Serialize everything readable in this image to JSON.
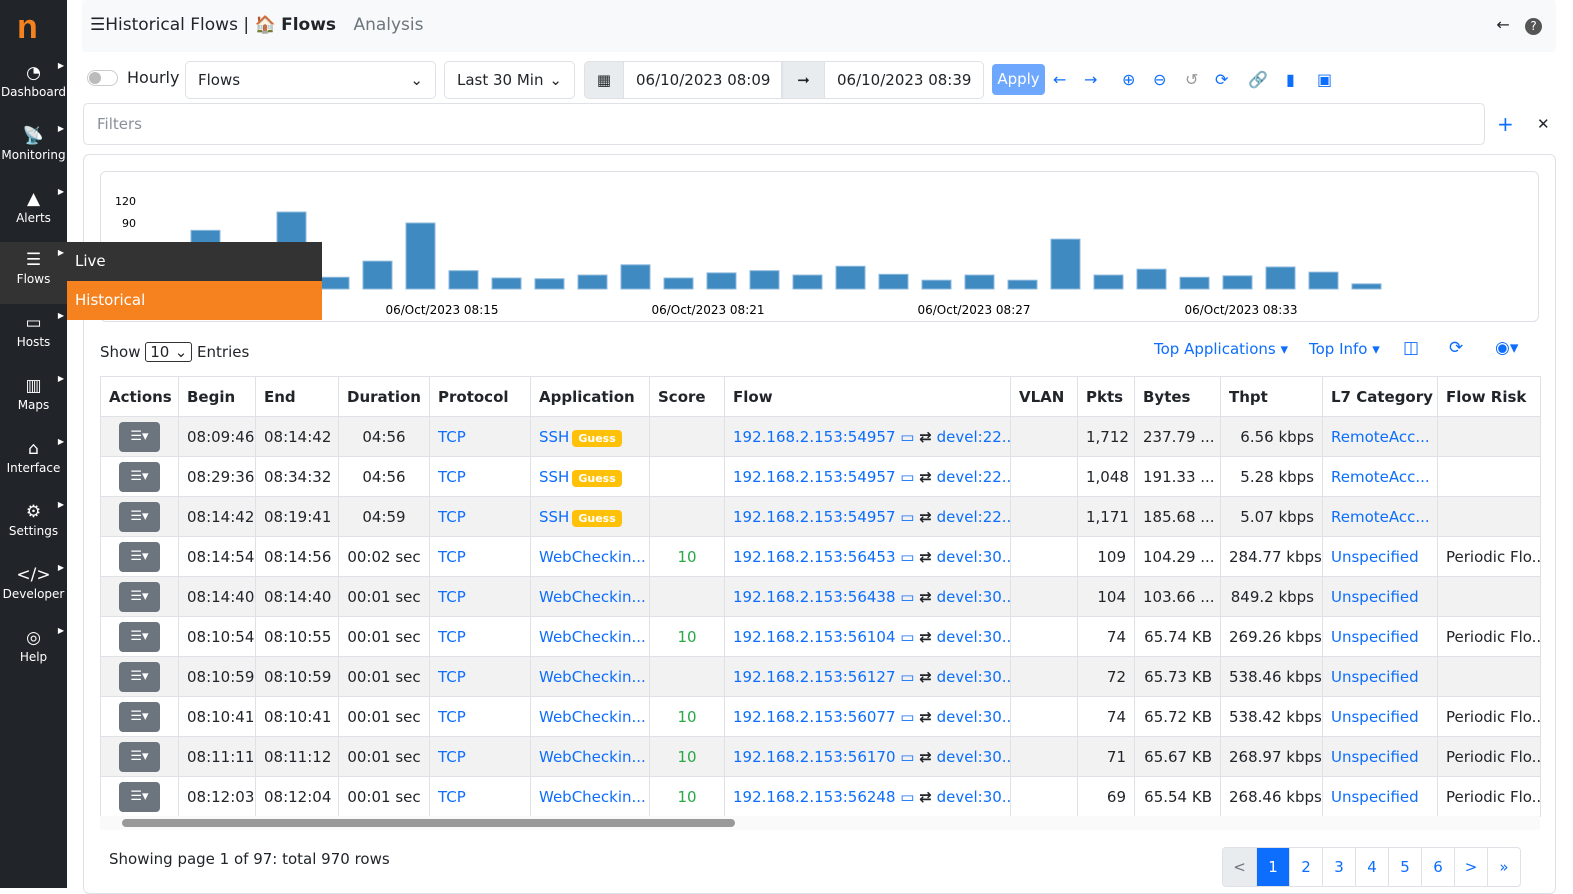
{
  "app": {
    "logo": "n"
  },
  "sidebar": {
    "items": [
      {
        "label": "Dashboard",
        "icon": "gauge-icon",
        "glyph": "◔"
      },
      {
        "label": "Monitoring",
        "icon": "satellite-dish-icon",
        "glyph": "📡"
      },
      {
        "label": "Alerts",
        "icon": "warning-icon",
        "glyph": "▲"
      },
      {
        "label": "Flows",
        "icon": "bars-icon",
        "glyph": "☰"
      },
      {
        "label": "Hosts",
        "icon": "laptop-icon",
        "glyph": "▭"
      },
      {
        "label": "Maps",
        "icon": "map-icon",
        "glyph": "▥"
      },
      {
        "label": "Interface",
        "icon": "ethernet-icon",
        "glyph": "⌂"
      },
      {
        "label": "Settings",
        "icon": "gear-icon",
        "glyph": "⚙"
      },
      {
        "label": "Developer",
        "icon": "code-icon",
        "glyph": "</>"
      },
      {
        "label": "Help",
        "icon": "life-ring-icon",
        "glyph": "◎"
      }
    ],
    "submenu": {
      "live": "Live",
      "historical": "Historical"
    }
  },
  "header": {
    "title": "Historical Flows",
    "separator": "|",
    "crumb": "Flows",
    "tab": "Analysis"
  },
  "toolbar": {
    "hourly_label": "Hourly",
    "hourly_on": false,
    "view_select": "Flows",
    "range_select": "Last 30 Min",
    "from": "06/10/2023 08:09",
    "to": "06/10/2023 08:39",
    "apply": "Apply"
  },
  "filters": {
    "placeholder": "Filters"
  },
  "chart_data": {
    "type": "bar",
    "yticks": [
      90,
      120
    ],
    "ylim": [
      0,
      120
    ],
    "xtick_labels": [
      "06/Oct/2023 08:15",
      "06/Oct/2023 08:21",
      "06/Oct/2023 08:27",
      "06/Oct/2023 08:33"
    ],
    "values": [
      20,
      30,
      80,
      40,
      105,
      16,
      38,
      90,
      25,
      15,
      14,
      19,
      33,
      15,
      22,
      25,
      19,
      31,
      20,
      12,
      19,
      12,
      68,
      19,
      27,
      16,
      18,
      30,
      23,
      7
    ],
    "color": "#3f8bc1"
  },
  "table_controls": {
    "show": "Show",
    "entries_value": "10",
    "entries": "Entries",
    "top_apps": "Top Applications",
    "top_info": "Top Info"
  },
  "table": {
    "columns": [
      "Actions",
      "Begin",
      "End",
      "Duration",
      "Protocol",
      "Application",
      "Score",
      "Flow",
      "VLAN",
      "Pkts",
      "Bytes",
      "Thpt",
      "L7 Category",
      "Flow Risk"
    ],
    "rows": [
      [
        "08:09:46",
        "08:14:42",
        "04:56",
        "TCP",
        "SSH",
        "Guess",
        "",
        "192.168.2.153:54957",
        "devel:22...",
        "",
        "1,712",
        "237.79 ...",
        "6.56 kbps",
        "RemoteAcc...",
        ""
      ],
      [
        "08:29:36",
        "08:34:32",
        "04:56",
        "TCP",
        "SSH",
        "Guess",
        "",
        "192.168.2.153:54957",
        "devel:22...",
        "",
        "1,048",
        "191.33 ...",
        "5.28 kbps",
        "RemoteAcc...",
        ""
      ],
      [
        "08:14:42",
        "08:19:41",
        "04:59",
        "TCP",
        "SSH",
        "Guess",
        "",
        "192.168.2.153:54957",
        "devel:22...",
        "",
        "1,171",
        "185.68 ...",
        "5.07 kbps",
        "RemoteAcc...",
        ""
      ],
      [
        "08:14:54",
        "08:14:56",
        "00:02 sec",
        "TCP",
        "WebCheckin...",
        "",
        "10",
        "192.168.2.153:56453",
        "devel:30...",
        "",
        "109",
        "104.29 ...",
        "284.77 kbps",
        "Unspecified",
        "Periodic Flo..."
      ],
      [
        "08:14:40",
        "08:14:40",
        "00:01 sec",
        "TCP",
        "WebCheckin...",
        "",
        "",
        "192.168.2.153:56438",
        "devel:30...",
        "",
        "104",
        "103.66 ...",
        "849.2 kbps",
        "Unspecified",
        ""
      ],
      [
        "08:10:54",
        "08:10:55",
        "00:01 sec",
        "TCP",
        "WebCheckin...",
        "",
        "10",
        "192.168.2.153:56104",
        "devel:30...",
        "",
        "74",
        "65.74 KB",
        "269.26 kbps",
        "Unspecified",
        "Periodic Flo..."
      ],
      [
        "08:10:59",
        "08:10:59",
        "00:01 sec",
        "TCP",
        "WebCheckin...",
        "",
        "",
        "192.168.2.153:56127",
        "devel:30...",
        "",
        "72",
        "65.73 KB",
        "538.46 kbps",
        "Unspecified",
        ""
      ],
      [
        "08:10:41",
        "08:10:41",
        "00:01 sec",
        "TCP",
        "WebCheckin...",
        "",
        "10",
        "192.168.2.153:56077",
        "devel:30...",
        "",
        "74",
        "65.72 KB",
        "538.42 kbps",
        "Unspecified",
        "Periodic Flo..."
      ],
      [
        "08:11:11",
        "08:11:12",
        "00:01 sec",
        "TCP",
        "WebCheckin...",
        "",
        "10",
        "192.168.2.153:56170",
        "devel:30...",
        "",
        "71",
        "65.67 KB",
        "268.97 kbps",
        "Unspecified",
        "Periodic Flo..."
      ],
      [
        "08:12:03",
        "08:12:04",
        "00:01 sec",
        "TCP",
        "WebCheckin...",
        "",
        "10",
        "192.168.2.153:56248",
        "devel:30...",
        "",
        "69",
        "65.54 KB",
        "268.46 kbps",
        "Unspecified",
        "Periodic Flo..."
      ]
    ]
  },
  "footer": {
    "summary": "Showing page 1 of 97: total 970 rows",
    "pages": [
      "<",
      "1",
      "2",
      "3",
      "4",
      "5",
      "6",
      ">",
      "»"
    ],
    "current": "1"
  }
}
